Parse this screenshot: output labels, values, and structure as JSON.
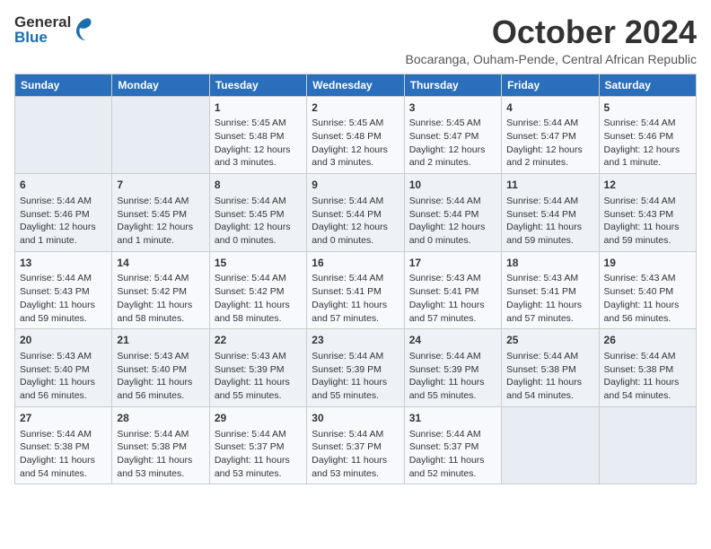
{
  "header": {
    "logo": {
      "line1": "General",
      "line2": "Blue"
    },
    "title": "October 2024",
    "location": "Bocaranga, Ouham-Pende, Central African Republic"
  },
  "days_of_week": [
    "Sunday",
    "Monday",
    "Tuesday",
    "Wednesday",
    "Thursday",
    "Friday",
    "Saturday"
  ],
  "weeks": [
    [
      {
        "day": "",
        "data": ""
      },
      {
        "day": "",
        "data": ""
      },
      {
        "day": "1",
        "data": "Sunrise: 5:45 AM\nSunset: 5:48 PM\nDaylight: 12 hours\nand 3 minutes."
      },
      {
        "day": "2",
        "data": "Sunrise: 5:45 AM\nSunset: 5:48 PM\nDaylight: 12 hours\nand 3 minutes."
      },
      {
        "day": "3",
        "data": "Sunrise: 5:45 AM\nSunset: 5:47 PM\nDaylight: 12 hours\nand 2 minutes."
      },
      {
        "day": "4",
        "data": "Sunrise: 5:44 AM\nSunset: 5:47 PM\nDaylight: 12 hours\nand 2 minutes."
      },
      {
        "day": "5",
        "data": "Sunrise: 5:44 AM\nSunset: 5:46 PM\nDaylight: 12 hours\nand 1 minute."
      }
    ],
    [
      {
        "day": "6",
        "data": "Sunrise: 5:44 AM\nSunset: 5:46 PM\nDaylight: 12 hours\nand 1 minute."
      },
      {
        "day": "7",
        "data": "Sunrise: 5:44 AM\nSunset: 5:45 PM\nDaylight: 12 hours\nand 1 minute."
      },
      {
        "day": "8",
        "data": "Sunrise: 5:44 AM\nSunset: 5:45 PM\nDaylight: 12 hours\nand 0 minutes."
      },
      {
        "day": "9",
        "data": "Sunrise: 5:44 AM\nSunset: 5:44 PM\nDaylight: 12 hours\nand 0 minutes."
      },
      {
        "day": "10",
        "data": "Sunrise: 5:44 AM\nSunset: 5:44 PM\nDaylight: 12 hours\nand 0 minutes."
      },
      {
        "day": "11",
        "data": "Sunrise: 5:44 AM\nSunset: 5:44 PM\nDaylight: 11 hours\nand 59 minutes."
      },
      {
        "day": "12",
        "data": "Sunrise: 5:44 AM\nSunset: 5:43 PM\nDaylight: 11 hours\nand 59 minutes."
      }
    ],
    [
      {
        "day": "13",
        "data": "Sunrise: 5:44 AM\nSunset: 5:43 PM\nDaylight: 11 hours\nand 59 minutes."
      },
      {
        "day": "14",
        "data": "Sunrise: 5:44 AM\nSunset: 5:42 PM\nDaylight: 11 hours\nand 58 minutes."
      },
      {
        "day": "15",
        "data": "Sunrise: 5:44 AM\nSunset: 5:42 PM\nDaylight: 11 hours\nand 58 minutes."
      },
      {
        "day": "16",
        "data": "Sunrise: 5:44 AM\nSunset: 5:41 PM\nDaylight: 11 hours\nand 57 minutes."
      },
      {
        "day": "17",
        "data": "Sunrise: 5:43 AM\nSunset: 5:41 PM\nDaylight: 11 hours\nand 57 minutes."
      },
      {
        "day": "18",
        "data": "Sunrise: 5:43 AM\nSunset: 5:41 PM\nDaylight: 11 hours\nand 57 minutes."
      },
      {
        "day": "19",
        "data": "Sunrise: 5:43 AM\nSunset: 5:40 PM\nDaylight: 11 hours\nand 56 minutes."
      }
    ],
    [
      {
        "day": "20",
        "data": "Sunrise: 5:43 AM\nSunset: 5:40 PM\nDaylight: 11 hours\nand 56 minutes."
      },
      {
        "day": "21",
        "data": "Sunrise: 5:43 AM\nSunset: 5:40 PM\nDaylight: 11 hours\nand 56 minutes."
      },
      {
        "day": "22",
        "data": "Sunrise: 5:43 AM\nSunset: 5:39 PM\nDaylight: 11 hours\nand 55 minutes."
      },
      {
        "day": "23",
        "data": "Sunrise: 5:44 AM\nSunset: 5:39 PM\nDaylight: 11 hours\nand 55 minutes."
      },
      {
        "day": "24",
        "data": "Sunrise: 5:44 AM\nSunset: 5:39 PM\nDaylight: 11 hours\nand 55 minutes."
      },
      {
        "day": "25",
        "data": "Sunrise: 5:44 AM\nSunset: 5:38 PM\nDaylight: 11 hours\nand 54 minutes."
      },
      {
        "day": "26",
        "data": "Sunrise: 5:44 AM\nSunset: 5:38 PM\nDaylight: 11 hours\nand 54 minutes."
      }
    ],
    [
      {
        "day": "27",
        "data": "Sunrise: 5:44 AM\nSunset: 5:38 PM\nDaylight: 11 hours\nand 54 minutes."
      },
      {
        "day": "28",
        "data": "Sunrise: 5:44 AM\nSunset: 5:38 PM\nDaylight: 11 hours\nand 53 minutes."
      },
      {
        "day": "29",
        "data": "Sunrise: 5:44 AM\nSunset: 5:37 PM\nDaylight: 11 hours\nand 53 minutes."
      },
      {
        "day": "30",
        "data": "Sunrise: 5:44 AM\nSunset: 5:37 PM\nDaylight: 11 hours\nand 53 minutes."
      },
      {
        "day": "31",
        "data": "Sunrise: 5:44 AM\nSunset: 5:37 PM\nDaylight: 11 hours\nand 52 minutes."
      },
      {
        "day": "",
        "data": ""
      },
      {
        "day": "",
        "data": ""
      }
    ]
  ]
}
